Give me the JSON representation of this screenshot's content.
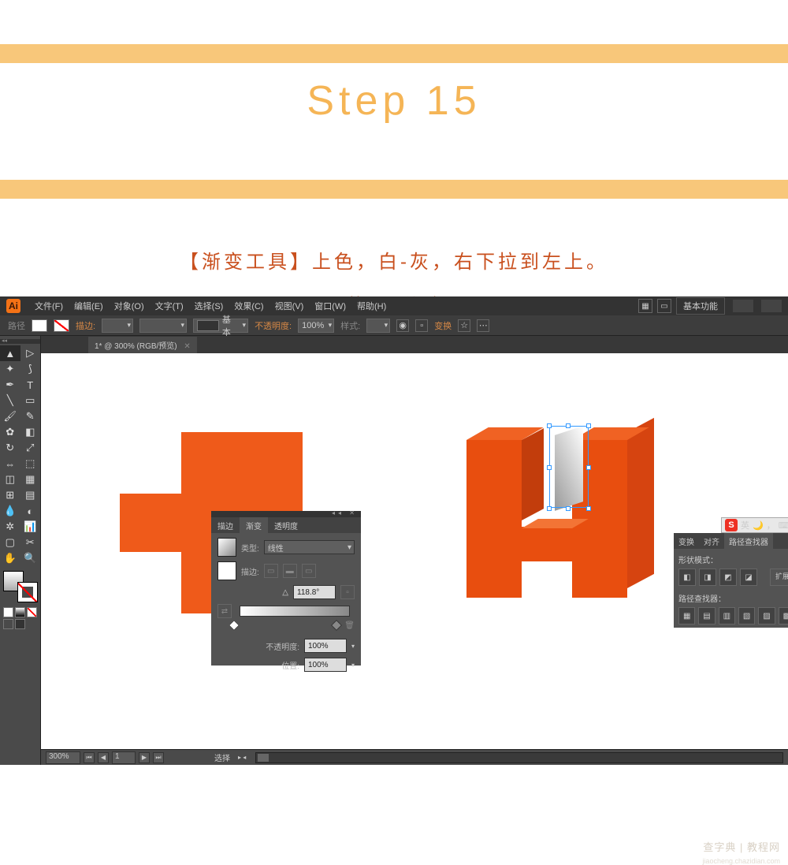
{
  "header": {
    "step_title": "Step 15",
    "instruction": "【渐变工具】上色，白-灰，右下拉到左上。",
    "sub_instruction": "（如下图所示）"
  },
  "ai": {
    "logo": "Ai",
    "menu": {
      "file": "文件(F)",
      "edit": "编辑(E)",
      "object": "对象(O)",
      "type": "文字(T)",
      "select": "选择(S)",
      "effect": "效果(C)",
      "view": "视图(V)",
      "window": "窗口(W)",
      "help": "帮助(H)"
    },
    "titlebar_right": {
      "essential": "基本功能"
    },
    "optionbar": {
      "path_label": "路径",
      "stroke_label": "描边:",
      "basic_label": "基本",
      "opacity_label": "不透明度:",
      "opacity_value": "100%",
      "style_label": "样式:",
      "transform_label": "变换"
    },
    "tab": {
      "title": "1* @ 300% (RGB/预览)",
      "close": "✕"
    },
    "gradient_panel": {
      "tab_stroke": "描边",
      "tab_gradient": "渐变",
      "tab_transparency": "透明度",
      "type_label": "类型:",
      "type_value": "线性",
      "stroke_label": "描边:",
      "angle_value": "118.8°",
      "opacity_label": "不透明度:",
      "opacity_value": "100%",
      "location_label": "位置:",
      "location_value": "100%"
    },
    "pathfinder_panel": {
      "tab_transform": "变换",
      "tab_align": "对齐",
      "tab_pathfinder": "路径查找器",
      "shape_mode": "形状模式：",
      "pathfinder_label": "路径查找器：",
      "expand": "扩展"
    },
    "ime": {
      "logo": "S",
      "text": "英",
      "moon": "🌙",
      "comma": "，"
    },
    "statusbar": {
      "zoom": "300%",
      "page": "1",
      "status": "选择"
    }
  },
  "watermark": {
    "main": "查字典 | 教程网",
    "sub": "jiaocheng.chazidian.com"
  }
}
